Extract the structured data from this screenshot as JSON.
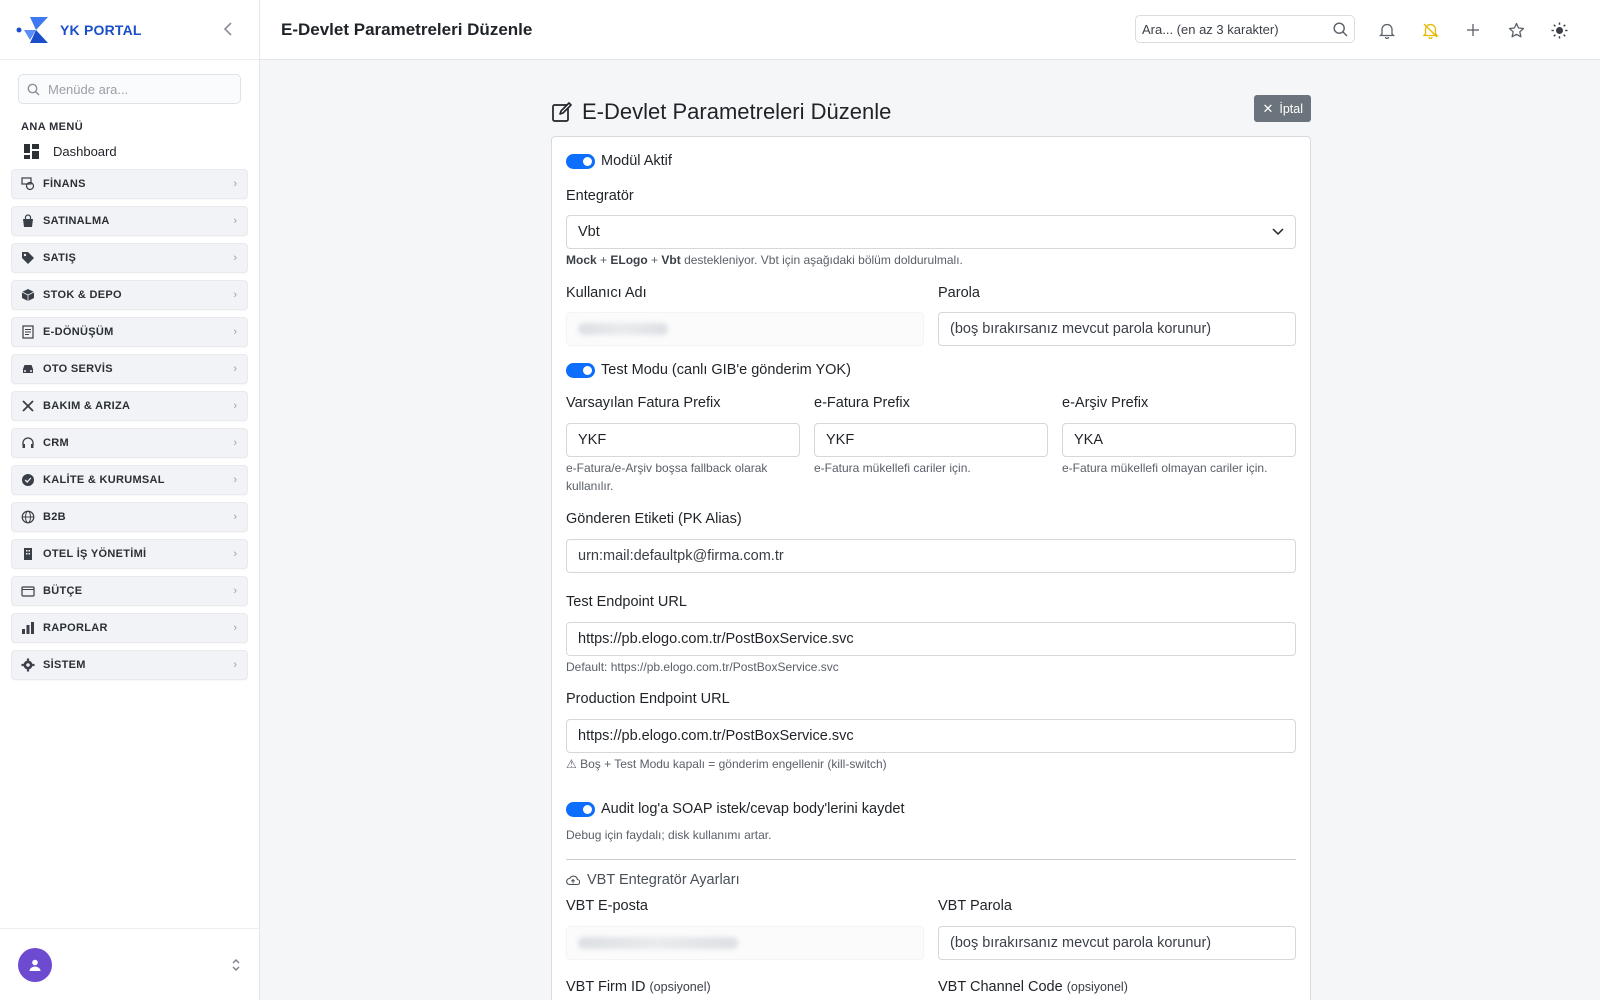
{
  "brand": {
    "name": "YK PORTAL"
  },
  "sidebar": {
    "search_placeholder": "Menüde ara...",
    "section_label": "ANA MENÜ",
    "dashboard_label": "Dashboard",
    "items": [
      {
        "label": "FİNANS",
        "icon": "finance-icon"
      },
      {
        "label": "SATINALMA",
        "icon": "shopping-bag-icon"
      },
      {
        "label": "SATIŞ",
        "icon": "tag-icon"
      },
      {
        "label": "STOK & DEPO",
        "icon": "box-icon"
      },
      {
        "label": "E-DÖNÜŞÜM",
        "icon": "document-icon"
      },
      {
        "label": "OTO SERVİS",
        "icon": "car-icon"
      },
      {
        "label": "BAKIM & ARIZA",
        "icon": "tools-icon"
      },
      {
        "label": "CRM",
        "icon": "headset-icon"
      },
      {
        "label": "KALİTE & KURUMSAL",
        "icon": "badge-check-icon"
      },
      {
        "label": "B2B",
        "icon": "globe-icon"
      },
      {
        "label": "OTEL İŞ YÖNETİMİ",
        "icon": "building-icon"
      },
      {
        "label": "BÜTÇE",
        "icon": "wallet-icon"
      },
      {
        "label": "RAPORLAR",
        "icon": "bar-chart-icon"
      },
      {
        "label": "SİSTEM",
        "icon": "gear-icon"
      }
    ]
  },
  "topbar": {
    "title": "E-Devlet Parametreleri Düzenle",
    "search_placeholder": "Ara... (en az 3 karakter)"
  },
  "main": {
    "title": "E-Devlet Parametreleri Düzenle",
    "cancel_label": "İptal"
  },
  "form": {
    "module_active_label": "Modül Aktif",
    "integrator_label": "Entegratör",
    "integrator_value": "Vbt",
    "integrator_help_p1": "Mock",
    "integrator_help_sep1": " + ",
    "integrator_help_p2": "ELogo",
    "integrator_help_sep2": " + ",
    "integrator_help_p3": "Vbt",
    "integrator_help_rest": " destekleniyor. Vbt için aşağıdaki bölüm doldurulmalı.",
    "username_label": "Kullanıcı Adı",
    "password_label": "Parola",
    "password_placeholder": "(boş bırakırsanız mevcut parola korunur)",
    "test_mode_label": "Test Modu (canlı GIB'e gönderim YOK)",
    "default_prefix_label": "Varsayılan Fatura Prefix",
    "default_prefix_value": "YKF",
    "default_prefix_help": "e-Fatura/e-Arşiv boşsa fallback olarak kullanılır.",
    "efatura_prefix_label": "e-Fatura Prefix",
    "efatura_prefix_value": "YKF",
    "efatura_prefix_help": "e-Fatura mükellefi cariler için.",
    "earsiv_prefix_label": "e-Arşiv Prefix",
    "earsiv_prefix_value": "YKA",
    "earsiv_prefix_help": "e-Fatura mükellefi olmayan cariler için.",
    "sender_alias_label": "Gönderen Etiketi (PK Alias)",
    "sender_alias_placeholder": "urn:mail:defaultpk@firma.com.tr",
    "test_endpoint_label": "Test Endpoint URL",
    "test_endpoint_value": "https://pb.elogo.com.tr/PostBoxService.svc",
    "test_endpoint_help": "Default: https://pb.elogo.com.tr/PostBoxService.svc",
    "prod_endpoint_label": "Production Endpoint URL",
    "prod_endpoint_value": "https://pb.elogo.com.tr/PostBoxService.svc",
    "prod_endpoint_help": "⚠ Boş + Test Modu kapalı = gönderim engellenir (kill-switch)",
    "audit_log_label": "Audit log'a SOAP istek/cevap body'lerini kaydet",
    "audit_log_help": "Debug için faydalı; disk kullanımı artar.",
    "vbt_section_title": "VBT Entegratör Ayarları",
    "vbt_email_label": "VBT E-posta",
    "vbt_password_label": "VBT Parola",
    "vbt_password_placeholder": "(boş bırakırsanız mevcut parola korunur)",
    "vbt_firm_label": "VBT Firm ID",
    "vbt_channel_label": "VBT Channel Code",
    "optional_label": "(opsiyonel)"
  },
  "colors": {
    "accent": "#0d6efd",
    "brand": "#1a4fc9",
    "cancel": "#6b737c",
    "avatar": "#6c4bd1",
    "bell_slash": "#e6b800"
  }
}
